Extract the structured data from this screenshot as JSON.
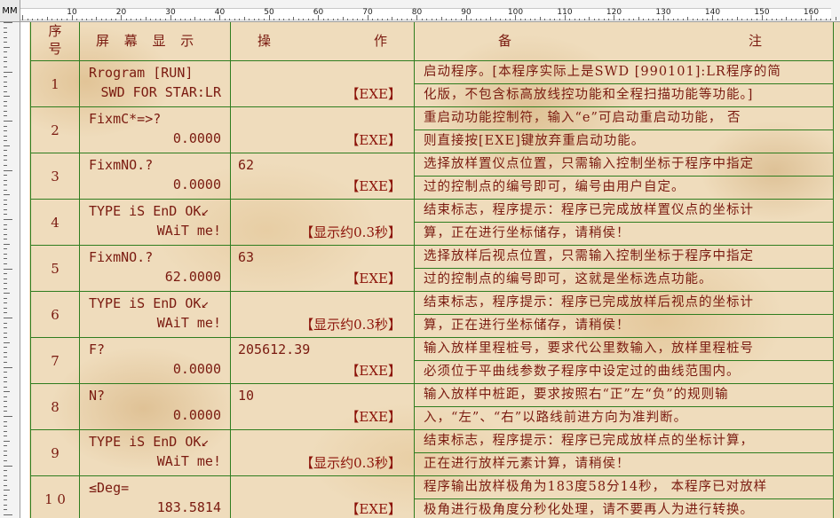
{
  "ruler": {
    "unit": "MM",
    "top_ticks": [
      "10",
      "20",
      "30",
      "40",
      "50",
      "60",
      "70",
      "80",
      "90",
      "100",
      "110",
      "120",
      "130",
      "140",
      "150",
      "160"
    ]
  },
  "table": {
    "headers": {
      "index": [
        "序",
        "号"
      ],
      "display": "屏  幕  显  示",
      "op_left": "操",
      "op_right": "作",
      "note_left": "备",
      "note_right": "注"
    },
    "rows": [
      {
        "idx": "1",
        "disp1": "Rrogram [RUN]",
        "disp2": "SWD FOR STAR:LR",
        "op1": "",
        "op2": "【EXE】",
        "note": [
          "启动程序。[本程序实际上是SWD [990101]:LR程序的简",
          "化版，不包含标高放线控功能和全程扫描功能等功能。]"
        ]
      },
      {
        "idx": "2",
        "disp1": "FixmC*=>?",
        "disp2": "0.0000",
        "op1": "",
        "op2": "【EXE】",
        "note": [
          "重启动功能控制符，输入“e”可启动重启动功能， 否",
          "则直接按[EXE]键放弃重启动功能。"
        ]
      },
      {
        "idx": "3",
        "disp1": "FixmNO.?",
        "disp2": "0.0000",
        "op1": "62",
        "op2": "【EXE】",
        "note": [
          "选择放样置仪点位置，只需输入控制坐标于程序中指定",
          "过的控制点的编号即可，编号由用户自定。"
        ]
      },
      {
        "idx": "4",
        "disp1": "TYPE iS EnD OK↙",
        "disp2": "WAiT me!",
        "op1": "",
        "op2": "【显示约0.3秒】",
        "note": [
          "结束标志，程序提示：程序已完成放样置仪点的坐标计",
          "算，正在进行坐标储存，请稍侯！"
        ]
      },
      {
        "idx": "5",
        "disp1": "FixmNO.?",
        "disp2": "62.0000",
        "op1": "63",
        "op2": "【EXE】",
        "note": [
          "选择放样后视点位置，只需输入控制坐标于程序中指定",
          "过的控制点的编号即可，这就是坐标选点功能。"
        ]
      },
      {
        "idx": "6",
        "disp1": "TYPE iS EnD OK↙",
        "disp2": "WAiT me!",
        "op1": "",
        "op2": "【显示约0.3秒】",
        "note": [
          "结束标志，程序提示：程序已完成放样后视点的坐标计",
          "算，正在进行坐标储存，请稍侯！"
        ]
      },
      {
        "idx": "7",
        "disp1": "F?",
        "disp2": "0.0000",
        "op1": "205612.39",
        "op2": "【EXE】",
        "note": [
          "输入放样里程桩号，要求代公里数输入，放样里程桩号",
          "必须位于平曲线参数子程序中设定过的曲线范围内。"
        ]
      },
      {
        "idx": "8",
        "disp1": "N?",
        "disp2": "0.0000",
        "op1": "10",
        "op2": "【EXE】",
        "note": [
          "输入放样中桩距，要求按照右“正”左“负”的规则输",
          "入，“左”、“右”以路线前进方向为准判断。"
        ]
      },
      {
        "idx": "9",
        "disp1": "TYPE iS EnD OK↙",
        "disp2": "WAiT me!",
        "op1": "",
        "op2": "【显示约0.3秒】",
        "note": [
          "结束标志，程序提示：程序已完成放样点的坐标计算，",
          "正在进行放样元素计算，请稍侯！"
        ]
      },
      {
        "idx": "1 0",
        "disp1": "≤Deg=",
        "disp2": "183.5814",
        "op1": "",
        "op2": "【EXE】",
        "note": [
          "程序输出放样极角为183度58分14秒， 本程序已对放样",
          "极角进行极角度分秒化处理，请不要再人为进行转换。"
        ]
      }
    ]
  }
}
